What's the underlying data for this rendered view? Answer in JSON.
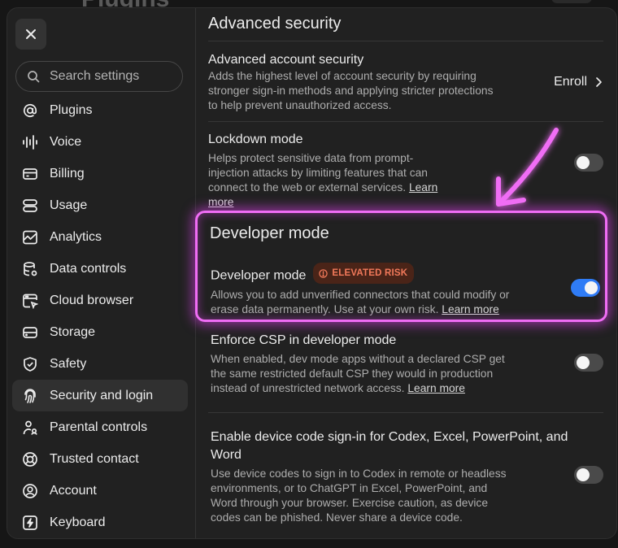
{
  "background": {
    "title": "Plugins"
  },
  "sidebar": {
    "search": {
      "placeholder": "Search settings"
    },
    "items": [
      {
        "label": "Plugins",
        "icon": "at-sign-icon"
      },
      {
        "label": "Voice",
        "icon": "waveform-icon"
      },
      {
        "label": "Billing",
        "icon": "credit-card-icon"
      },
      {
        "label": "Usage",
        "icon": "usage-icon"
      },
      {
        "label": "Analytics",
        "icon": "line-chart-icon"
      },
      {
        "label": "Data controls",
        "icon": "database-icon"
      },
      {
        "label": "Cloud browser",
        "icon": "cloud-browser-icon"
      },
      {
        "label": "Storage",
        "icon": "storage-icon"
      },
      {
        "label": "Safety",
        "icon": "shield-icon"
      },
      {
        "label": "Security and login",
        "icon": "fingerprint-icon",
        "active": true
      },
      {
        "label": "Parental controls",
        "icon": "parental-icon"
      },
      {
        "label": "Trusted contact",
        "icon": "lifebuoy-icon"
      },
      {
        "label": "Account",
        "icon": "account-icon"
      },
      {
        "label": "Keyboard",
        "icon": "keyboard-icon"
      }
    ]
  },
  "main": {
    "section_title": "Advanced security",
    "advanced_account": {
      "title": "Advanced account security",
      "desc": "Adds the highest level of account security by requiring stronger sign-in methods and applying stricter protections to help prevent unauthorized access.",
      "action": "Enroll"
    },
    "lockdown": {
      "title": "Lockdown mode",
      "desc": "Helps protect sensitive data from prompt-injection attacks by limiting features that can connect to the web or external services.",
      "link": "Learn more",
      "enabled": false
    },
    "developer_section_title": "Developer mode",
    "developer": {
      "title": "Developer mode",
      "badge": "ELEVATED RISK",
      "desc": "Allows you to add unverified connectors that could modify or erase data permanently. Use at your own risk.",
      "link": "Learn more",
      "enabled": true
    },
    "csp": {
      "title": "Enforce CSP in developer mode",
      "desc": "When enabled, dev mode apps without a declared CSP get the same restricted default CSP they would in production instead of unrestricted network access.",
      "link": "Learn more",
      "enabled": false
    },
    "device_code": {
      "title": "Enable device code sign-in for Codex, Excel, PowerPoint, and Word",
      "desc": "Use device codes to sign in to Codex in remote or headless environments, or to ChatGPT in Excel, PowerPoint, and Word through your browser. Exercise caution, as device codes can be phished. Never share a device code.",
      "enabled": false
    }
  },
  "colors": {
    "accent": "#2f7cf6",
    "highlight": "#f06df5",
    "badge_text": "#f2795a",
    "badge_bg": "#4a2418"
  }
}
